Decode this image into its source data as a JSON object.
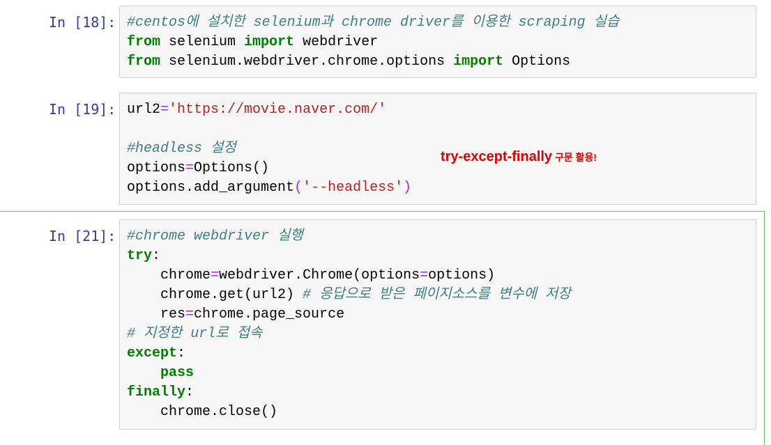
{
  "cells": [
    {
      "prompt": "In [18]:",
      "lines": {
        "l1": {
          "comment": "#centos에 설치한 selenium과 chrome driver를 이용한 scraping 실습"
        },
        "l2": {
          "kw1": "from",
          "t1": " selenium ",
          "kw2": "import",
          "t2": " webdriver"
        },
        "l3": {
          "kw1": "from",
          "t1": " selenium.webdriver.chrome.options ",
          "kw2": "import",
          "t2": " Options"
        }
      }
    },
    {
      "prompt": "In [19]:",
      "lines": {
        "l1": {
          "t1": "url2",
          "op": "=",
          "str": "'https://movie.naver.com/'"
        },
        "l2": {
          "comment": "#headless 설정"
        },
        "l3": {
          "t1": "options",
          "op": "=",
          "t2": "Options()"
        },
        "l4": {
          "t1": "options.add_argument",
          "p1": "(",
          "str": "'--headless'",
          "p2": ")"
        }
      },
      "annotation": {
        "main": "try-except-finally",
        "sub": " 구문 활용!"
      }
    },
    {
      "prompt": "In [21]:",
      "lines": {
        "l1": {
          "comment": "#chrome webdriver 실행"
        },
        "l2": {
          "kw": "try",
          "t": ":"
        },
        "l3": {
          "t1": "    chrome",
          "op1": "=",
          "t2": "webdriver.Chrome(options",
          "op2": "=",
          "t3": "options)"
        },
        "l4": {
          "t1": "    chrome.get(url2) ",
          "comment": "# 응답으로 받은 페이지소스를 변수에 저장"
        },
        "l5": {
          "t1": "    res",
          "op": "=",
          "t2": "chrome.page_source"
        },
        "l6": {
          "comment": "# 지정한 url로 접속"
        },
        "l7": {
          "kw": "except",
          "t": ":"
        },
        "l8": {
          "indent": "    ",
          "kw": "pass"
        },
        "l9": {
          "kw": "finally",
          "t": ":"
        },
        "l10": {
          "t": "    chrome.close()"
        }
      }
    }
  ],
  "colors": {
    "prompt": "#303f9f",
    "keyword": "#008000",
    "string": "#ba2121",
    "operator": "#aa22ff",
    "comment": "#408080",
    "annotation": "#e00000",
    "selected_border": "#66bb6a"
  }
}
